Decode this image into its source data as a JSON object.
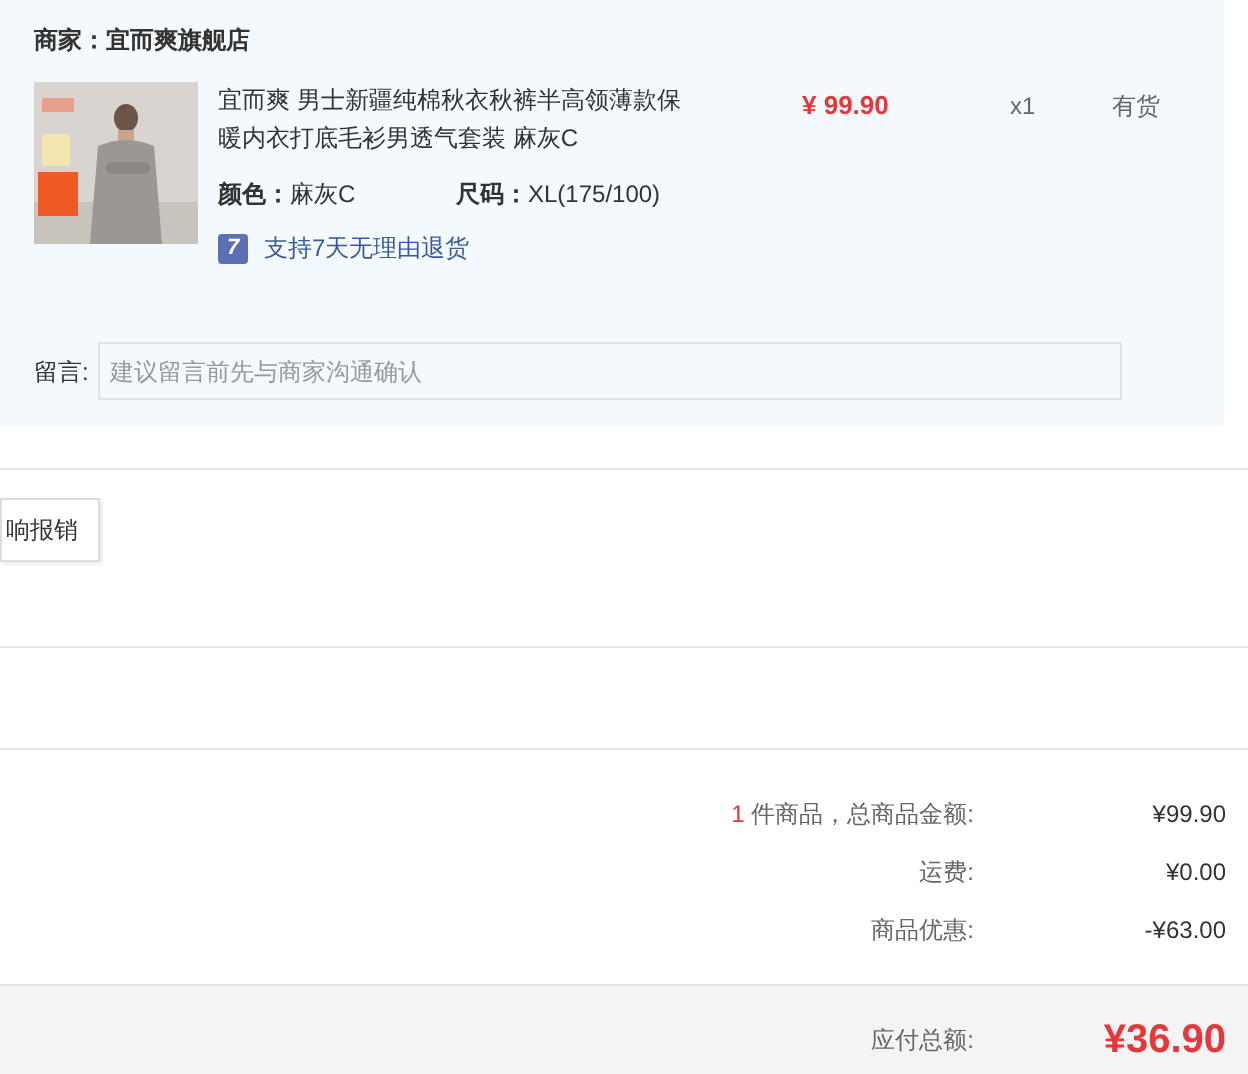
{
  "order": {
    "merchant_label": "商家：",
    "merchant_name": "宜而爽旗舰店",
    "item": {
      "title": "宜而爽 男士新疆纯棉秋衣秋裤半高领薄款保暖内衣打底毛衫男透气套装 麻灰C",
      "price": "¥ 99.90",
      "quantity": "x1",
      "stock": "有货",
      "specs": [
        {
          "label": "颜色：",
          "value": "麻灰C"
        },
        {
          "label": "尺码：",
          "value": "XL(175/100)"
        }
      ],
      "return_badge": "7",
      "return_policy": "支持7天无理由退货"
    },
    "message": {
      "label": "留言:",
      "placeholder": "建议留言前先与商家沟通确认"
    }
  },
  "invoice_button": "响报销",
  "summary": [
    {
      "count": "1",
      "label": " 件商品，总商品金额:",
      "value": "¥99.90"
    },
    {
      "label": "运费:",
      "value": "¥0.00"
    },
    {
      "label": "商品优惠:",
      "value": "-¥63.00"
    }
  ],
  "total": {
    "label": "应付总额:",
    "value": "¥36.90"
  }
}
